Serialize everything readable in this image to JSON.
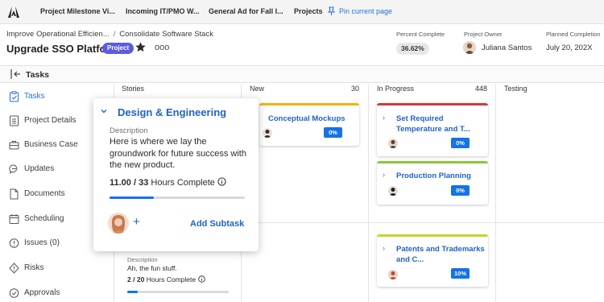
{
  "top_tabs": [
    {
      "label": "Project Milestone Vi..."
    },
    {
      "label": "Incoming IT/PMO W..."
    },
    {
      "label": "General Ad for Fall I..."
    },
    {
      "label": "Projects"
    }
  ],
  "pin_label": "Pin current page",
  "breadcrumb": {
    "parent": "Improve Operational Efficien...",
    "separator": "/",
    "current": "Consolidate Software Stack"
  },
  "page_title": "Upgrade SSO Platform",
  "project_badge": "Project",
  "more_label": "ooo",
  "meta": {
    "percent_label": "Percent Complete",
    "percent_value": "36.62%",
    "owner_label": "Project Owner",
    "owner_name": "Juliana Santos",
    "completion_label": "Planned Completion",
    "completion_value": "July 20, 202X"
  },
  "section_title": "Tasks",
  "sidebar": {
    "items": [
      {
        "label": "Tasks",
        "icon": "clipboard-check-icon",
        "active": true
      },
      {
        "label": "Project Details",
        "icon": "document-list-icon"
      },
      {
        "label": "Business Case",
        "icon": "briefcase-icon"
      },
      {
        "label": "Updates",
        "icon": "chat-bubble-icon"
      },
      {
        "label": "Documents",
        "icon": "file-icon"
      },
      {
        "label": "Scheduling",
        "icon": "calendar-icon"
      },
      {
        "label": "Issues (0)",
        "icon": "alert-circle-icon"
      },
      {
        "label": "Risks",
        "icon": "risk-diamond-icon"
      },
      {
        "label": "Approvals",
        "icon": "check-circle-icon"
      }
    ]
  },
  "board": {
    "columns": [
      {
        "label": "Stories",
        "count": ""
      },
      {
        "label": "New",
        "count": "30"
      },
      {
        "label": "In Progress",
        "count": "448"
      },
      {
        "label": "Testing",
        "count": ""
      }
    ],
    "cards": [
      {
        "title": "Conceptual Mockups",
        "percent": "0%",
        "accent": "#f5b400"
      },
      {
        "title": "Set Required Temperature and T...",
        "percent": "0%",
        "accent": "#d7373f"
      },
      {
        "title": "Production Planning",
        "percent": "0%",
        "accent": "#8cc63f"
      },
      {
        "title": "Patents and Trademarks and C...",
        "percent": "10%",
        "accent": "#c8d429"
      }
    ]
  },
  "popover": {
    "title": "Design & Engineering",
    "description_label": "Description",
    "description": "Here is where we lay the groundwork for future success with the new product.",
    "hours_done": "11.00",
    "hours_sep": "/",
    "hours_total": "33",
    "hours_suffix": "Hours Complete",
    "progress": 0.33,
    "add_label": "Add Subtask"
  },
  "story2": {
    "description_label": "Description",
    "description": "Ah, the fun stuff.",
    "hours_done": "2",
    "hours_sep": "/",
    "hours_total": "20",
    "hours_suffix": "Hours Complete",
    "progress": 0.1
  },
  "colors": {
    "accent_blue": "#1473e6",
    "link_blue": "#1f63c8",
    "project_badge": "#5c5ce0"
  }
}
